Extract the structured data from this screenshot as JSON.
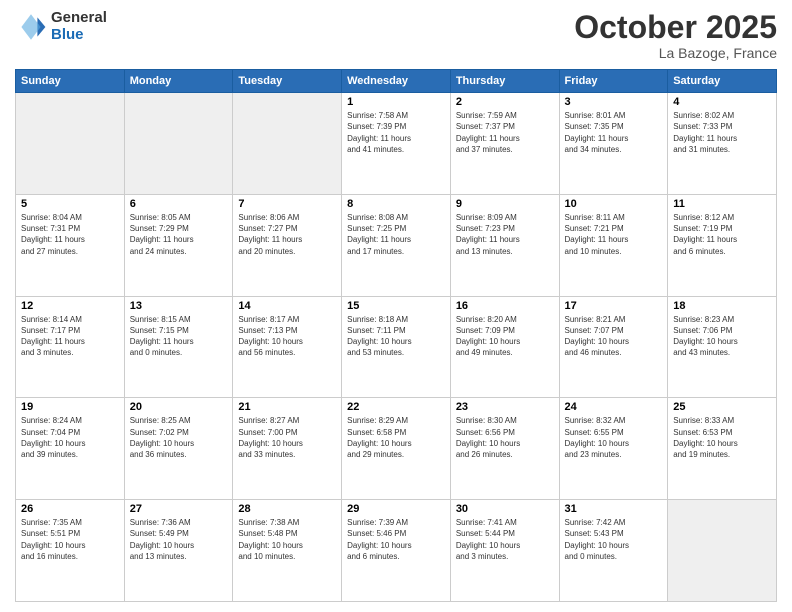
{
  "header": {
    "logo_general": "General",
    "logo_blue": "Blue",
    "month_title": "October 2025",
    "location": "La Bazoge, France"
  },
  "weekdays": [
    "Sunday",
    "Monday",
    "Tuesday",
    "Wednesday",
    "Thursday",
    "Friday",
    "Saturday"
  ],
  "weeks": [
    [
      {
        "day": "",
        "info": ""
      },
      {
        "day": "",
        "info": ""
      },
      {
        "day": "",
        "info": ""
      },
      {
        "day": "1",
        "info": "Sunrise: 7:58 AM\nSunset: 7:39 PM\nDaylight: 11 hours\nand 41 minutes."
      },
      {
        "day": "2",
        "info": "Sunrise: 7:59 AM\nSunset: 7:37 PM\nDaylight: 11 hours\nand 37 minutes."
      },
      {
        "day": "3",
        "info": "Sunrise: 8:01 AM\nSunset: 7:35 PM\nDaylight: 11 hours\nand 34 minutes."
      },
      {
        "day": "4",
        "info": "Sunrise: 8:02 AM\nSunset: 7:33 PM\nDaylight: 11 hours\nand 31 minutes."
      }
    ],
    [
      {
        "day": "5",
        "info": "Sunrise: 8:04 AM\nSunset: 7:31 PM\nDaylight: 11 hours\nand 27 minutes."
      },
      {
        "day": "6",
        "info": "Sunrise: 8:05 AM\nSunset: 7:29 PM\nDaylight: 11 hours\nand 24 minutes."
      },
      {
        "day": "7",
        "info": "Sunrise: 8:06 AM\nSunset: 7:27 PM\nDaylight: 11 hours\nand 20 minutes."
      },
      {
        "day": "8",
        "info": "Sunrise: 8:08 AM\nSunset: 7:25 PM\nDaylight: 11 hours\nand 17 minutes."
      },
      {
        "day": "9",
        "info": "Sunrise: 8:09 AM\nSunset: 7:23 PM\nDaylight: 11 hours\nand 13 minutes."
      },
      {
        "day": "10",
        "info": "Sunrise: 8:11 AM\nSunset: 7:21 PM\nDaylight: 11 hours\nand 10 minutes."
      },
      {
        "day": "11",
        "info": "Sunrise: 8:12 AM\nSunset: 7:19 PM\nDaylight: 11 hours\nand 6 minutes."
      }
    ],
    [
      {
        "day": "12",
        "info": "Sunrise: 8:14 AM\nSunset: 7:17 PM\nDaylight: 11 hours\nand 3 minutes."
      },
      {
        "day": "13",
        "info": "Sunrise: 8:15 AM\nSunset: 7:15 PM\nDaylight: 11 hours\nand 0 minutes."
      },
      {
        "day": "14",
        "info": "Sunrise: 8:17 AM\nSunset: 7:13 PM\nDaylight: 10 hours\nand 56 minutes."
      },
      {
        "day": "15",
        "info": "Sunrise: 8:18 AM\nSunset: 7:11 PM\nDaylight: 10 hours\nand 53 minutes."
      },
      {
        "day": "16",
        "info": "Sunrise: 8:20 AM\nSunset: 7:09 PM\nDaylight: 10 hours\nand 49 minutes."
      },
      {
        "day": "17",
        "info": "Sunrise: 8:21 AM\nSunset: 7:07 PM\nDaylight: 10 hours\nand 46 minutes."
      },
      {
        "day": "18",
        "info": "Sunrise: 8:23 AM\nSunset: 7:06 PM\nDaylight: 10 hours\nand 43 minutes."
      }
    ],
    [
      {
        "day": "19",
        "info": "Sunrise: 8:24 AM\nSunset: 7:04 PM\nDaylight: 10 hours\nand 39 minutes."
      },
      {
        "day": "20",
        "info": "Sunrise: 8:25 AM\nSunset: 7:02 PM\nDaylight: 10 hours\nand 36 minutes."
      },
      {
        "day": "21",
        "info": "Sunrise: 8:27 AM\nSunset: 7:00 PM\nDaylight: 10 hours\nand 33 minutes."
      },
      {
        "day": "22",
        "info": "Sunrise: 8:29 AM\nSunset: 6:58 PM\nDaylight: 10 hours\nand 29 minutes."
      },
      {
        "day": "23",
        "info": "Sunrise: 8:30 AM\nSunset: 6:56 PM\nDaylight: 10 hours\nand 26 minutes."
      },
      {
        "day": "24",
        "info": "Sunrise: 8:32 AM\nSunset: 6:55 PM\nDaylight: 10 hours\nand 23 minutes."
      },
      {
        "day": "25",
        "info": "Sunrise: 8:33 AM\nSunset: 6:53 PM\nDaylight: 10 hours\nand 19 minutes."
      }
    ],
    [
      {
        "day": "26",
        "info": "Sunrise: 7:35 AM\nSunset: 5:51 PM\nDaylight: 10 hours\nand 16 minutes."
      },
      {
        "day": "27",
        "info": "Sunrise: 7:36 AM\nSunset: 5:49 PM\nDaylight: 10 hours\nand 13 minutes."
      },
      {
        "day": "28",
        "info": "Sunrise: 7:38 AM\nSunset: 5:48 PM\nDaylight: 10 hours\nand 10 minutes."
      },
      {
        "day": "29",
        "info": "Sunrise: 7:39 AM\nSunset: 5:46 PM\nDaylight: 10 hours\nand 6 minutes."
      },
      {
        "day": "30",
        "info": "Sunrise: 7:41 AM\nSunset: 5:44 PM\nDaylight: 10 hours\nand 3 minutes."
      },
      {
        "day": "31",
        "info": "Sunrise: 7:42 AM\nSunset: 5:43 PM\nDaylight: 10 hours\nand 0 minutes."
      },
      {
        "day": "",
        "info": ""
      }
    ]
  ]
}
